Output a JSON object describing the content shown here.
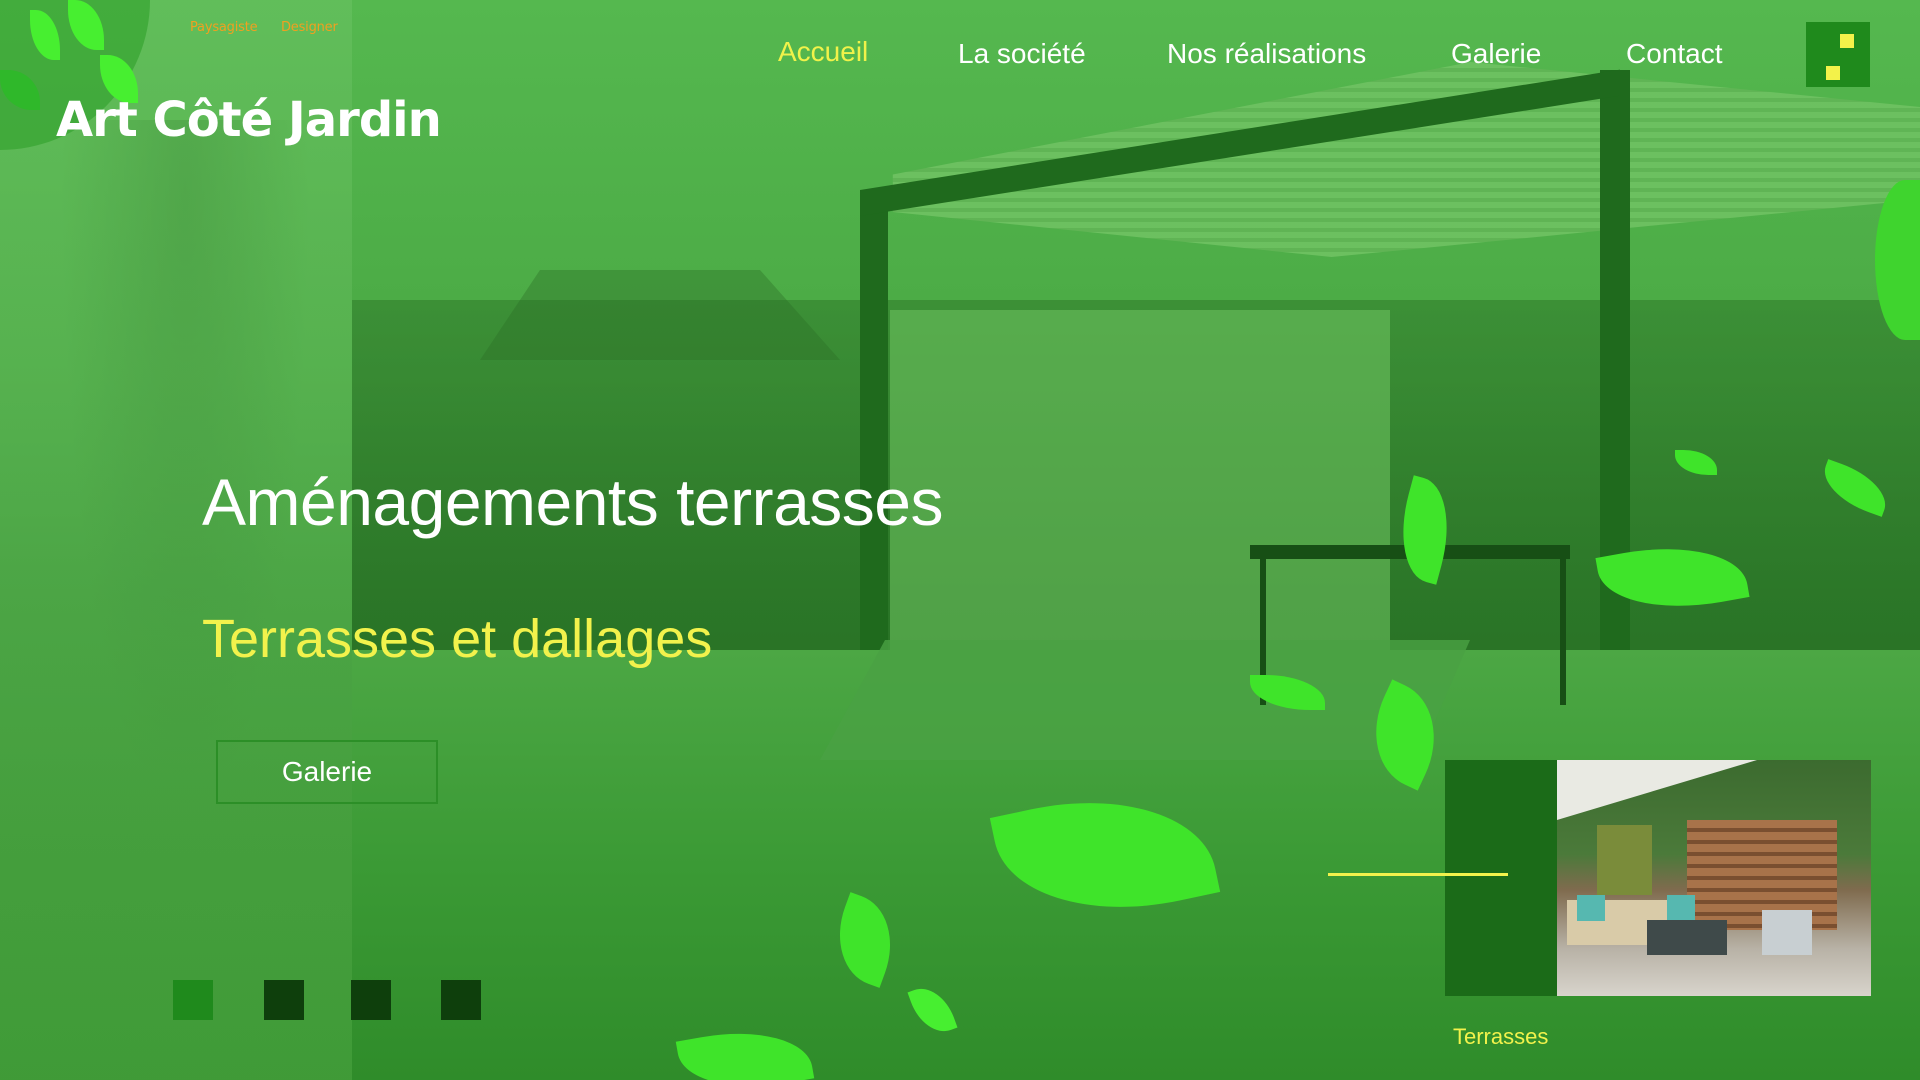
{
  "brand": {
    "tagline_1": "Paysagiste",
    "tagline_2": "Designer",
    "name": "Art Côté Jardin"
  },
  "nav": {
    "items": [
      {
        "label": "Accueil",
        "active": true
      },
      {
        "label": "La société",
        "active": false
      },
      {
        "label": "Nos réalisations",
        "active": false
      },
      {
        "label": "Galerie",
        "active": false
      },
      {
        "label": "Contact",
        "active": false
      }
    ],
    "menu_icon": "grid-menu-icon"
  },
  "hero": {
    "title": "Aménagements terrasses",
    "subtitle": "Terrasses et dallages",
    "button_label": "Galerie"
  },
  "slider": {
    "active_index": 0,
    "total": 4,
    "next_preview_label": "Terrasses"
  },
  "colors": {
    "accent": "#f2f24c",
    "primary_green": "#1f8a1c",
    "tagline_orange": "#f0a020",
    "dot_active": "#1f8a1c",
    "dot_inactive": "#0e3f0c"
  }
}
